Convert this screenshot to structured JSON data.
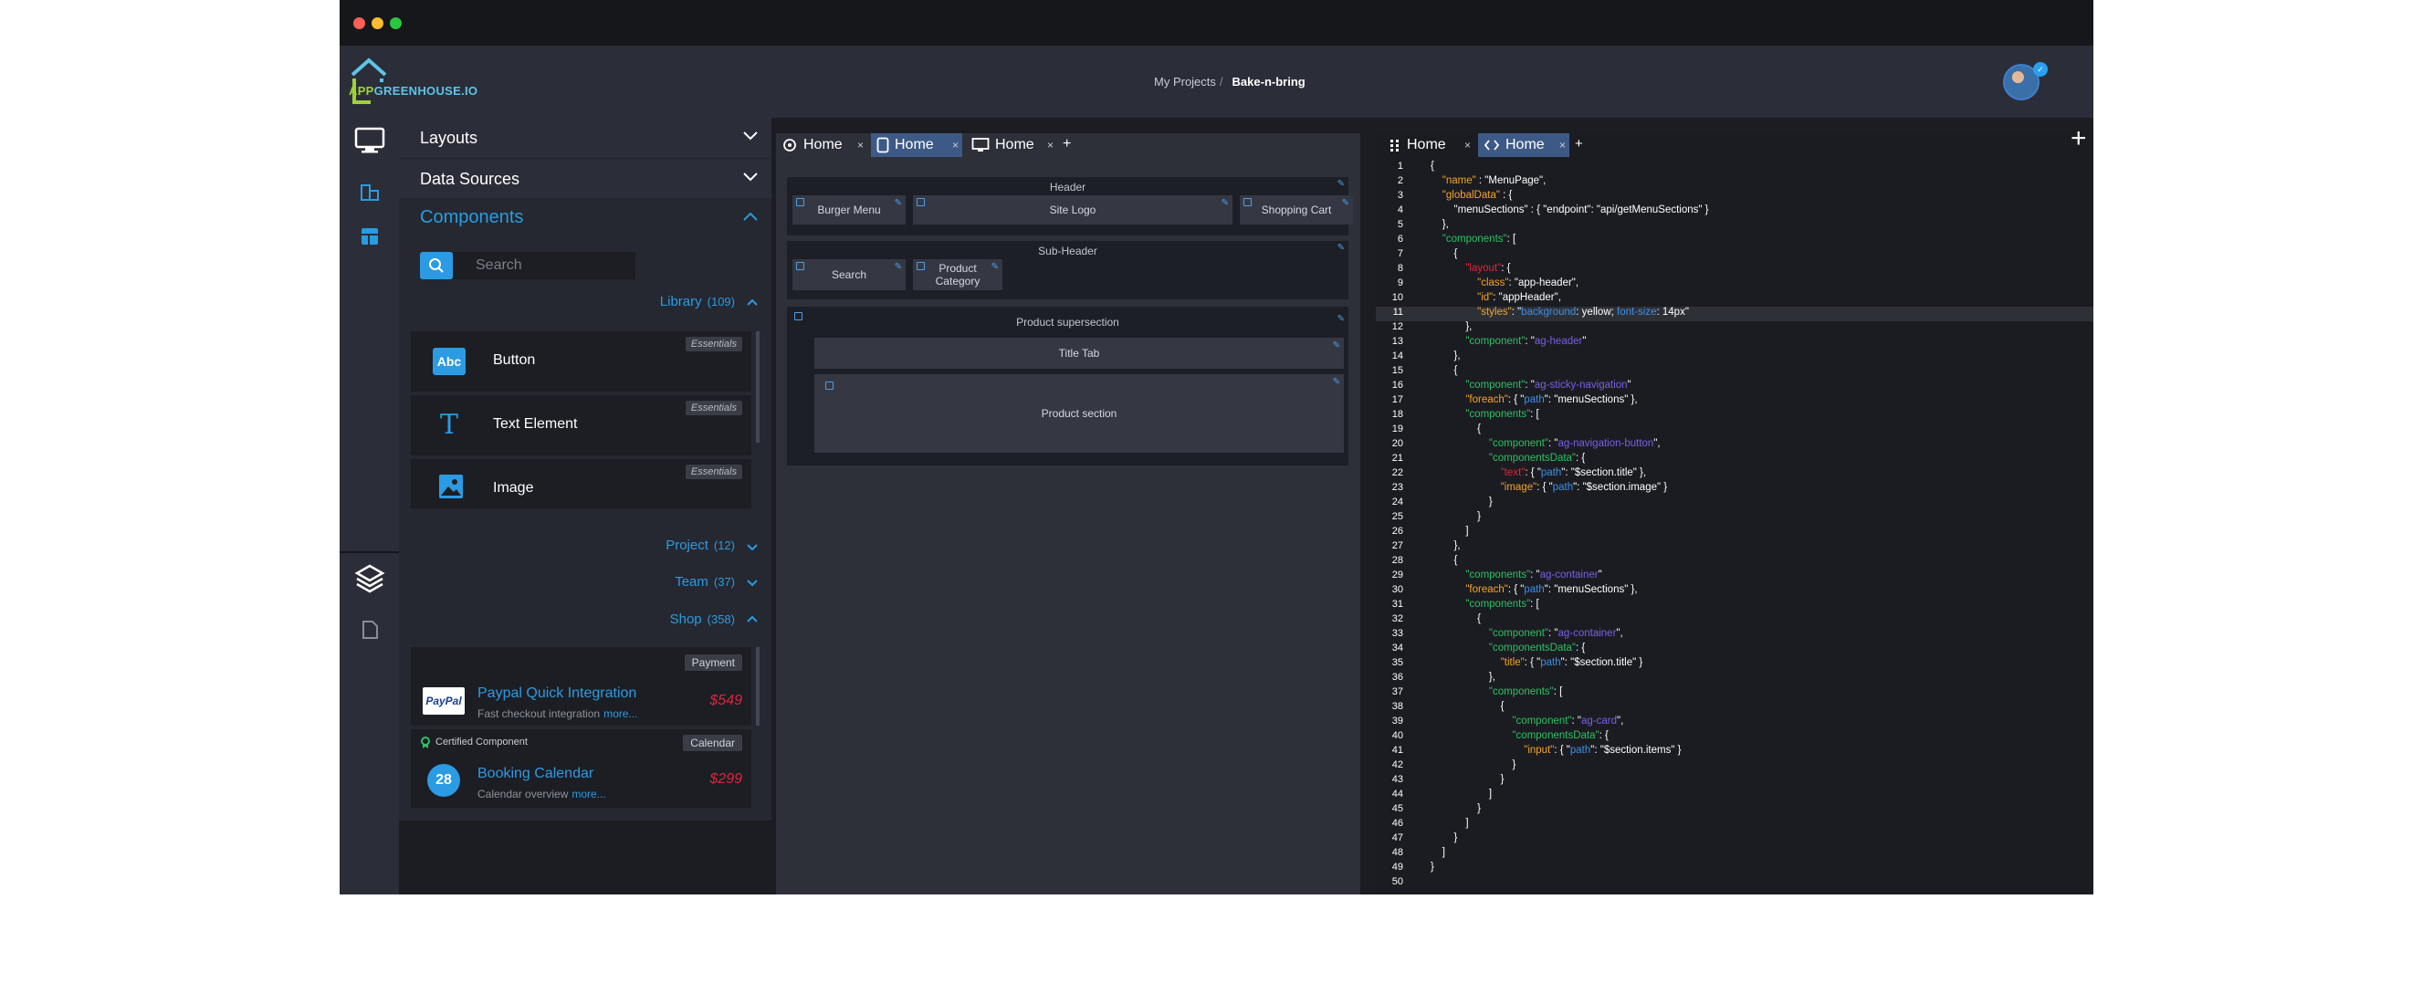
{
  "colors": {
    "accent": "#2b9be3",
    "price": "#e0243e",
    "bg": "#1c1d22"
  },
  "header": {
    "logo_app": "APP",
    "logo_rest": "GREENHOUSE.IO",
    "breadcrumb_parent": "My Projects",
    "breadcrumb_sep": "/",
    "breadcrumb_current": "Bake-n-bring"
  },
  "rail": {
    "icons": [
      "monitor-icon",
      "layers-small-icon",
      "layout-icon",
      "stack-icon",
      "page-icon"
    ]
  },
  "panel": {
    "layouts": "Layouts",
    "data_sources": "Data Sources",
    "components": "Components",
    "search_placeholder": "Search",
    "library": {
      "label": "Library",
      "count": "(109)"
    },
    "library_items": [
      {
        "label": "Button",
        "tag": "Essentials",
        "icon": "Abc"
      },
      {
        "label": "Text Element",
        "tag": "Essentials",
        "icon": "T"
      },
      {
        "label": "Image",
        "tag": "Essentials",
        "icon": "image-icon"
      }
    ],
    "project": {
      "label": "Project",
      "count": "(12)"
    },
    "team": {
      "label": "Team",
      "count": "(37)"
    },
    "shop": {
      "label": "Shop",
      "count": "(358)"
    },
    "shop_items": [
      {
        "tag": "Payment",
        "title": "Paypal Quick Integration",
        "sub": "Fast checkout integration",
        "more": "more...",
        "price": "$549",
        "logo": "PayPal"
      },
      {
        "tag": "Calendar",
        "certified": "Certified Component",
        "title": "Booking Calendar",
        "sub": "Calendar overview",
        "more": "more...",
        "price": "$299",
        "logo": "28"
      }
    ]
  },
  "design": {
    "tabs": [
      "Home",
      "Home",
      "Home"
    ],
    "plus": "+",
    "header_title": "Header",
    "burger": "Burger Menu",
    "site_logo": "Site Logo",
    "cart": "Shopping Cart",
    "subheader_title": "Sub-Header",
    "search": "Search",
    "product_category": "Product Category",
    "supersection": "Product supersection",
    "title_tab": "Title Tab",
    "product_section": "Product section"
  },
  "code": {
    "tabs": [
      "Home",
      "Home"
    ],
    "plus": "+",
    "big_plus": "+",
    "lines": [
      [
        [
          "w",
          "{"
        ]
      ],
      [
        [
          "w",
          "    "
        ],
        [
          "k",
          "\"name\""
        ],
        [
          "w",
          " : \"MenuPage\","
        ]
      ],
      [
        [
          "w",
          "    "
        ],
        [
          "k",
          "\"globalData\""
        ],
        [
          "w",
          " : {"
        ]
      ],
      [
        [
          "w",
          "        \"menuSections\" : { \"endpoint\": \"api/getMenuSections\" }"
        ]
      ],
      [
        [
          "w",
          "    },"
        ]
      ],
      [
        [
          "w",
          "    "
        ],
        [
          "g",
          "\"components\""
        ],
        [
          "w",
          ": ["
        ]
      ],
      [
        [
          "w",
          "        {"
        ]
      ],
      [
        [
          "w",
          "            "
        ],
        [
          "k2",
          "\"layout\""
        ],
        [
          "w",
          ": {"
        ]
      ],
      [
        [
          "w",
          "                "
        ],
        [
          "k",
          "\"class\""
        ],
        [
          "w",
          ": \"app-header\","
        ]
      ],
      [
        [
          "w",
          "                "
        ],
        [
          "k",
          "\"id\""
        ],
        [
          "w",
          ": \"appHeader\","
        ]
      ],
      [
        [
          "w",
          "                "
        ],
        [
          "k",
          "\"styles\""
        ],
        [
          "w",
          ": \""
        ],
        [
          "b",
          "background"
        ],
        [
          "w",
          ": yellow; "
        ],
        [
          "b",
          "font-size"
        ],
        [
          "w",
          ": 14px\""
        ]
      ],
      [
        [
          "w",
          "            },"
        ]
      ],
      [
        [
          "w",
          "            "
        ],
        [
          "g",
          "\"component\""
        ],
        [
          "w",
          ": \""
        ],
        [
          "p",
          "ag-header"
        ],
        [
          "w",
          "\""
        ]
      ],
      [
        [
          "w",
          "        },"
        ]
      ],
      [
        [
          "w",
          "        {"
        ]
      ],
      [
        [
          "w",
          "            "
        ],
        [
          "g",
          "\"component\""
        ],
        [
          "w",
          ": \""
        ],
        [
          "p",
          "ag-sticky-navigation"
        ],
        [
          "w",
          "\""
        ]
      ],
      [
        [
          "w",
          "            "
        ],
        [
          "k",
          "\"foreach\""
        ],
        [
          "w",
          ": { \""
        ],
        [
          "b",
          "path"
        ],
        [
          "w",
          "\": \"menuSections\" },"
        ]
      ],
      [
        [
          "w",
          "            "
        ],
        [
          "g",
          "\"components\""
        ],
        [
          "w",
          ": ["
        ]
      ],
      [
        [
          "w",
          "                {"
        ]
      ],
      [
        [
          "w",
          "                    "
        ],
        [
          "g",
          "\"component\""
        ],
        [
          "w",
          ": \""
        ],
        [
          "p",
          "ag-navigation-button"
        ],
        [
          "w",
          "\","
        ]
      ],
      [
        [
          "w",
          "                    "
        ],
        [
          "g",
          "\"componentsData\""
        ],
        [
          "w",
          ": {"
        ]
      ],
      [
        [
          "w",
          "                        "
        ],
        [
          "k2",
          "\"text\""
        ],
        [
          "w",
          ": { \""
        ],
        [
          "b",
          "path"
        ],
        [
          "w",
          "\": \"$section.title\" },"
        ]
      ],
      [
        [
          "w",
          "                        "
        ],
        [
          "k",
          "\"image\""
        ],
        [
          "w",
          ": { \""
        ],
        [
          "b",
          "path"
        ],
        [
          "w",
          "\": \"$section.image\" }"
        ]
      ],
      [
        [
          "w",
          "                    }"
        ]
      ],
      [
        [
          "w",
          "                }"
        ]
      ],
      [
        [
          "w",
          "            ]"
        ]
      ],
      [
        [
          "w",
          "        },"
        ]
      ],
      [
        [
          "w",
          "        {"
        ]
      ],
      [
        [
          "w",
          "            "
        ],
        [
          "g",
          "\"components\""
        ],
        [
          "w",
          ": \""
        ],
        [
          "p",
          "ag-container"
        ],
        [
          "w",
          "\""
        ]
      ],
      [
        [
          "w",
          "            "
        ],
        [
          "k",
          "\"foreach\""
        ],
        [
          "w",
          ": { \""
        ],
        [
          "b",
          "path"
        ],
        [
          "w",
          "\": \"menuSections\" },"
        ]
      ],
      [
        [
          "w",
          "            "
        ],
        [
          "g",
          "\"components\""
        ],
        [
          "w",
          ": ["
        ]
      ],
      [
        [
          "w",
          "                {"
        ]
      ],
      [
        [
          "w",
          "                    "
        ],
        [
          "g",
          "\"component\""
        ],
        [
          "w",
          ": \""
        ],
        [
          "p",
          "ag-container"
        ],
        [
          "w",
          "\","
        ]
      ],
      [
        [
          "w",
          "                    "
        ],
        [
          "g",
          "\"componentsData\""
        ],
        [
          "w",
          ": {"
        ]
      ],
      [
        [
          "w",
          "                        "
        ],
        [
          "k",
          "\"title\""
        ],
        [
          "w",
          ": { \""
        ],
        [
          "b",
          "path"
        ],
        [
          "w",
          "\": \"$section.title\" }"
        ]
      ],
      [
        [
          "w",
          "                    },"
        ]
      ],
      [
        [
          "w",
          "                    "
        ],
        [
          "g",
          "\"components\""
        ],
        [
          "w",
          ": ["
        ]
      ],
      [
        [
          "w",
          "                        {"
        ]
      ],
      [
        [
          "w",
          "                            "
        ],
        [
          "g",
          "\"component\""
        ],
        [
          "w",
          ": \""
        ],
        [
          "p",
          "ag-card"
        ],
        [
          "w",
          "\","
        ]
      ],
      [
        [
          "w",
          "                            "
        ],
        [
          "g",
          "\"componentsData\""
        ],
        [
          "w",
          ": {"
        ]
      ],
      [
        [
          "w",
          "                                "
        ],
        [
          "k",
          "\"input\""
        ],
        [
          "w",
          ": { \""
        ],
        [
          "b",
          "path"
        ],
        [
          "w",
          "\": \"$section.items\" }"
        ]
      ],
      [
        [
          "w",
          "                            }"
        ]
      ],
      [
        [
          "w",
          "                        }"
        ]
      ],
      [
        [
          "w",
          "                    ]"
        ]
      ],
      [
        [
          "w",
          "                }"
        ]
      ],
      [
        [
          "w",
          "            ]"
        ]
      ],
      [
        [
          "w",
          "        }"
        ]
      ],
      [
        [
          "w",
          "    ]"
        ]
      ],
      [
        [
          "w",
          "}"
        ]
      ],
      [
        [
          "w",
          ""
        ]
      ]
    ]
  }
}
